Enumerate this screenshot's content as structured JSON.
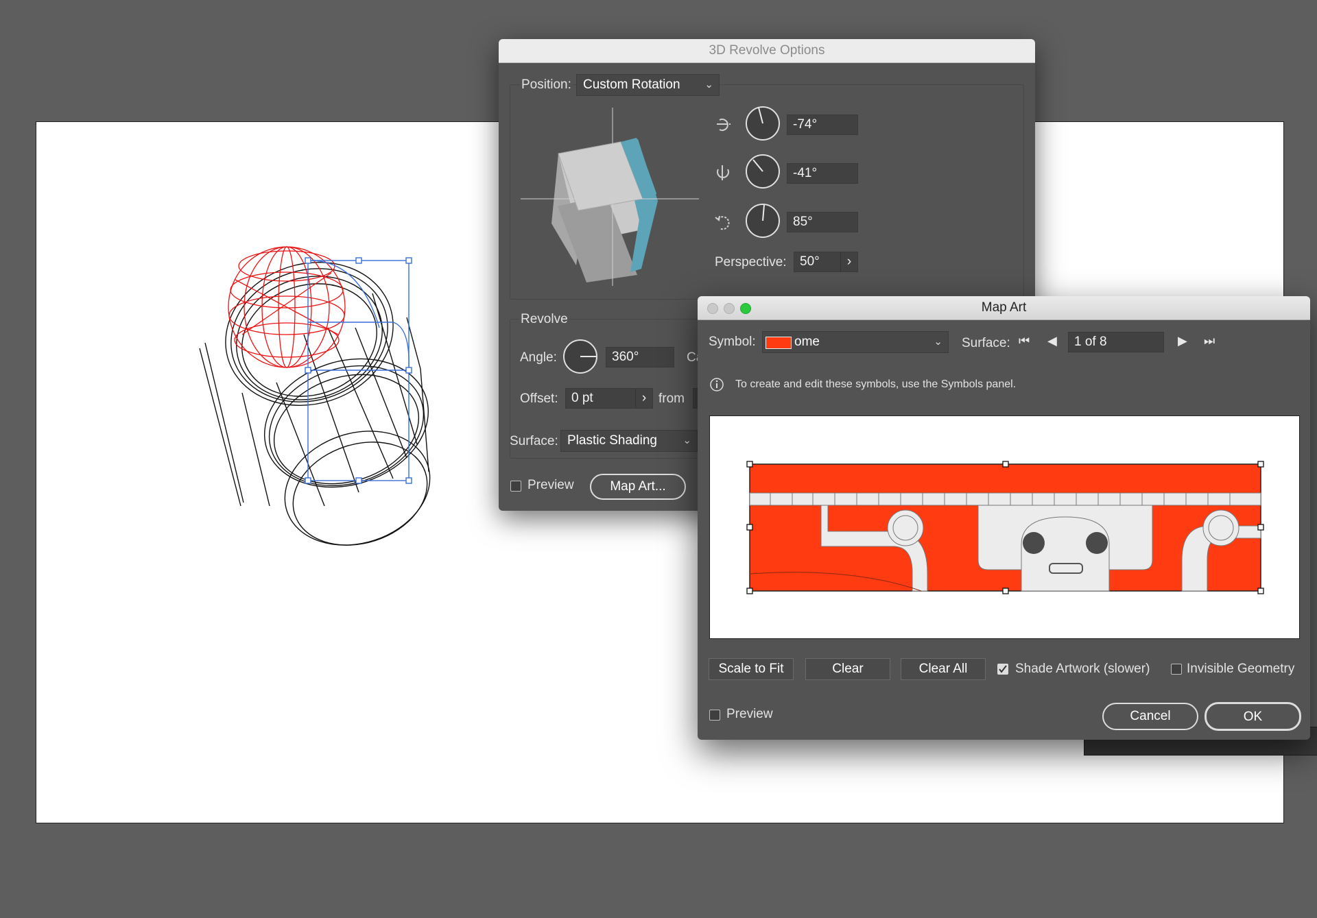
{
  "revolve_dialog": {
    "title": "3D Revolve Options",
    "position_label": "Position:",
    "position_value": "Custom Rotation",
    "rotation_x": "-74°",
    "rotation_y": "-41°",
    "rotation_z": "85°",
    "perspective_label": "Perspective:",
    "perspective_value": "50°",
    "revolve_heading": "Revolve",
    "angle_label": "Angle:",
    "angle_value": "360°",
    "cap_partial": "Ca",
    "offset_label": "Offset:",
    "offset_value": "0 pt",
    "from_label": "from",
    "surface_label": "Surface:",
    "surface_value": "Plastic Shading",
    "preview_label": "Preview",
    "map_art_button": "Map Art..."
  },
  "map_art_dialog": {
    "title": "Map Art",
    "symbol_label": "Symbol:",
    "symbol_value": "ome",
    "surface_label": "Surface:",
    "surface_counter": "1 of 8",
    "info_text": "To create and edit these symbols, use the Symbols panel.",
    "scale_to_fit": "Scale to Fit",
    "clear": "Clear",
    "clear_all": "Clear All",
    "shade_artwork_label": "Shade Artwork (slower)",
    "shade_artwork_checked": true,
    "invisible_geometry_label": "Invisible Geometry",
    "invisible_geometry_checked": false,
    "preview_label": "Preview",
    "preview_checked": false,
    "cancel": "Cancel",
    "ok": "OK"
  },
  "colors": {
    "workspace": "#5e5e5e",
    "dialog": "#535353",
    "symbol_red": "#ff3b12",
    "cube_face_side": "#5ea4b8",
    "selection_blue": "#3a6fd8",
    "traffic_red": "#c9c9c9",
    "traffic_green": "#2bc840"
  },
  "icons": {
    "rotate_x": "rotate-x-axis-icon",
    "rotate_y": "rotate-y-axis-icon",
    "rotate_z": "rotate-z-axis-icon",
    "info": "info-icon"
  }
}
